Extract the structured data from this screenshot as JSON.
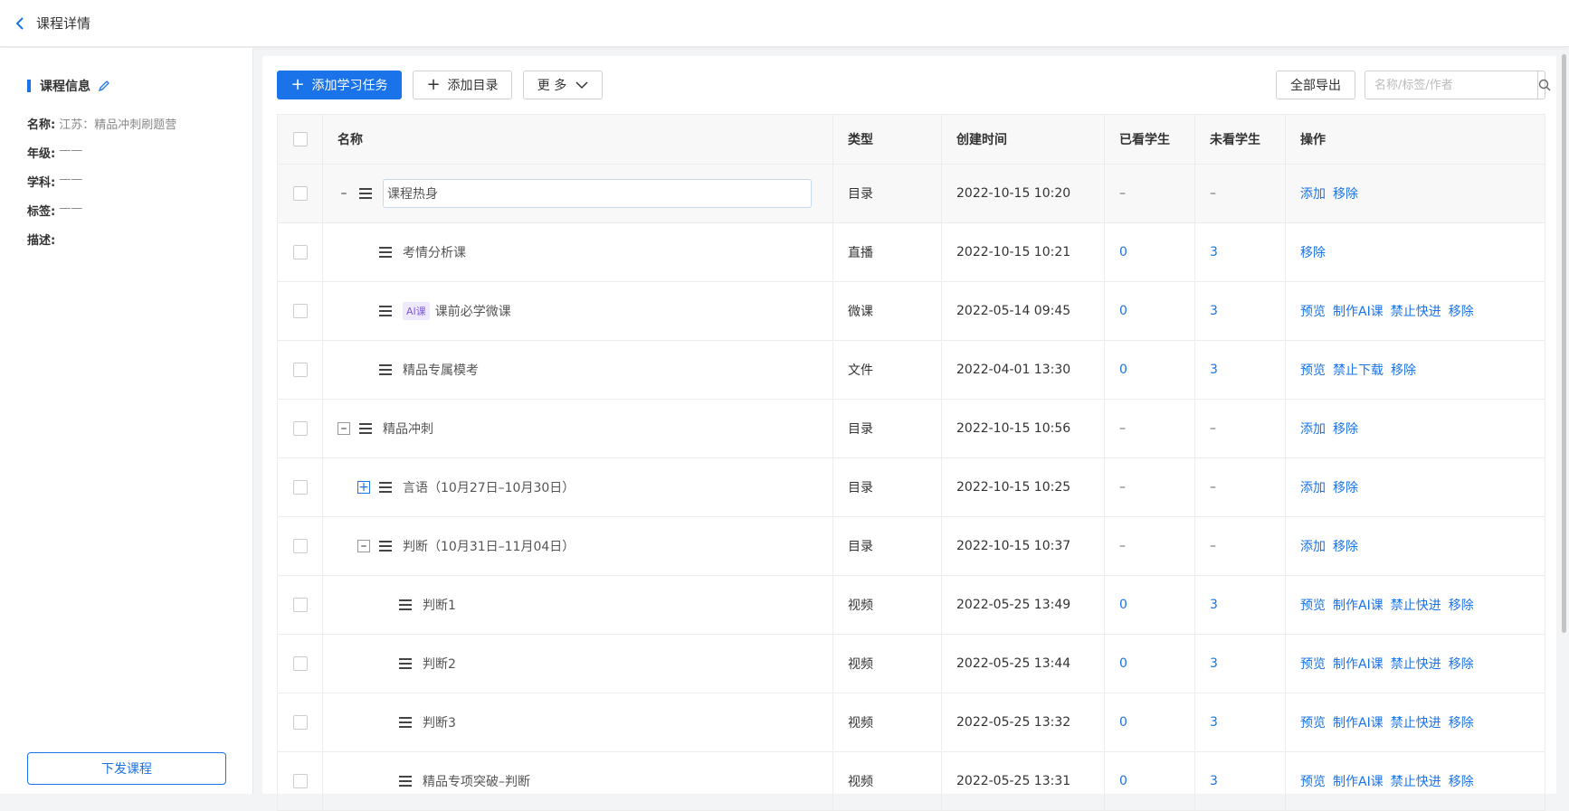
{
  "header": {
    "title": "课程详情"
  },
  "sidebar": {
    "section_title": "课程信息",
    "fields": [
      {
        "label": "名称:",
        "value": "江苏：精品冲刺刷题营"
      },
      {
        "label": "年级:",
        "value": "——"
      },
      {
        "label": "学科:",
        "value": "——"
      },
      {
        "label": "标签:",
        "value": "——"
      },
      {
        "label": "描述:",
        "value": ""
      }
    ],
    "publish_label": "下发课程"
  },
  "toolbar": {
    "add_task_label": "添加学习任务",
    "add_dir_label": "添加目录",
    "more_label": "更 多",
    "export_label": "全部导出",
    "search_placeholder": "名称/标签/作者"
  },
  "table": {
    "headers": [
      "名称",
      "类型",
      "创建时间",
      "已看学生",
      "未看学生",
      "操作"
    ],
    "rows": [
      {
        "name": "课程热身",
        "type": "目录",
        "time": "2022-10-15 10:20",
        "seen": "–",
        "unseen": "–",
        "ops": [
          "添加",
          "移除"
        ]
      },
      {
        "name": "考情分析课",
        "type": "直播",
        "time": "2022-10-15 10:21",
        "seen": "0",
        "unseen": "3",
        "ops": [
          "移除"
        ]
      },
      {
        "badge": "AI课",
        "name": "课前必学微课",
        "type": "微课",
        "time": "2022-05-14 09:45",
        "seen": "0",
        "unseen": "3",
        "ops": [
          "预览",
          "制作AI课",
          "禁止快进",
          "移除"
        ]
      },
      {
        "name": "精品专属模考",
        "type": "文件",
        "time": "2022-04-01 13:30",
        "seen": "0",
        "unseen": "3",
        "ops": [
          "预览",
          "禁止下载",
          "移除"
        ]
      },
      {
        "name": "精品冲刺",
        "type": "目录",
        "time": "2022-10-15 10:56",
        "seen": "–",
        "unseen": "–",
        "ops": [
          "添加",
          "移除"
        ]
      },
      {
        "name": "言语（10月27日–10月30日）",
        "type": "目录",
        "time": "2022-10-15 10:25",
        "seen": "–",
        "unseen": "–",
        "ops": [
          "添加",
          "移除"
        ]
      },
      {
        "name": "判断（10月31日–11月04日）",
        "type": "目录",
        "time": "2022-10-15 10:37",
        "seen": "–",
        "unseen": "–",
        "ops": [
          "添加",
          "移除"
        ]
      },
      {
        "name": "判断1",
        "type": "视频",
        "time": "2022-05-25 13:49",
        "seen": "0",
        "unseen": "3",
        "ops": [
          "预览",
          "制作AI课",
          "禁止快进",
          "移除"
        ]
      },
      {
        "name": "判断2",
        "type": "视频",
        "time": "2022-05-25 13:44",
        "seen": "0",
        "unseen": "3",
        "ops": [
          "预览",
          "制作AI课",
          "禁止快进",
          "移除"
        ]
      },
      {
        "name": "判断3",
        "type": "视频",
        "time": "2022-05-25 13:32",
        "seen": "0",
        "unseen": "3",
        "ops": [
          "预览",
          "制作AI课",
          "禁止快进",
          "移除"
        ]
      },
      {
        "name": "精品专项突破–判断",
        "type": "视频",
        "time": "2022-05-25 13:31",
        "seen": "0",
        "unseen": "3",
        "ops": [
          "预览",
          "制作AI课",
          "禁止快进",
          "移除"
        ]
      }
    ]
  },
  "colors": {
    "accent": "#1a73e8",
    "badge_text": "#7b5cd6",
    "badge_bg": "#efe9fd"
  }
}
